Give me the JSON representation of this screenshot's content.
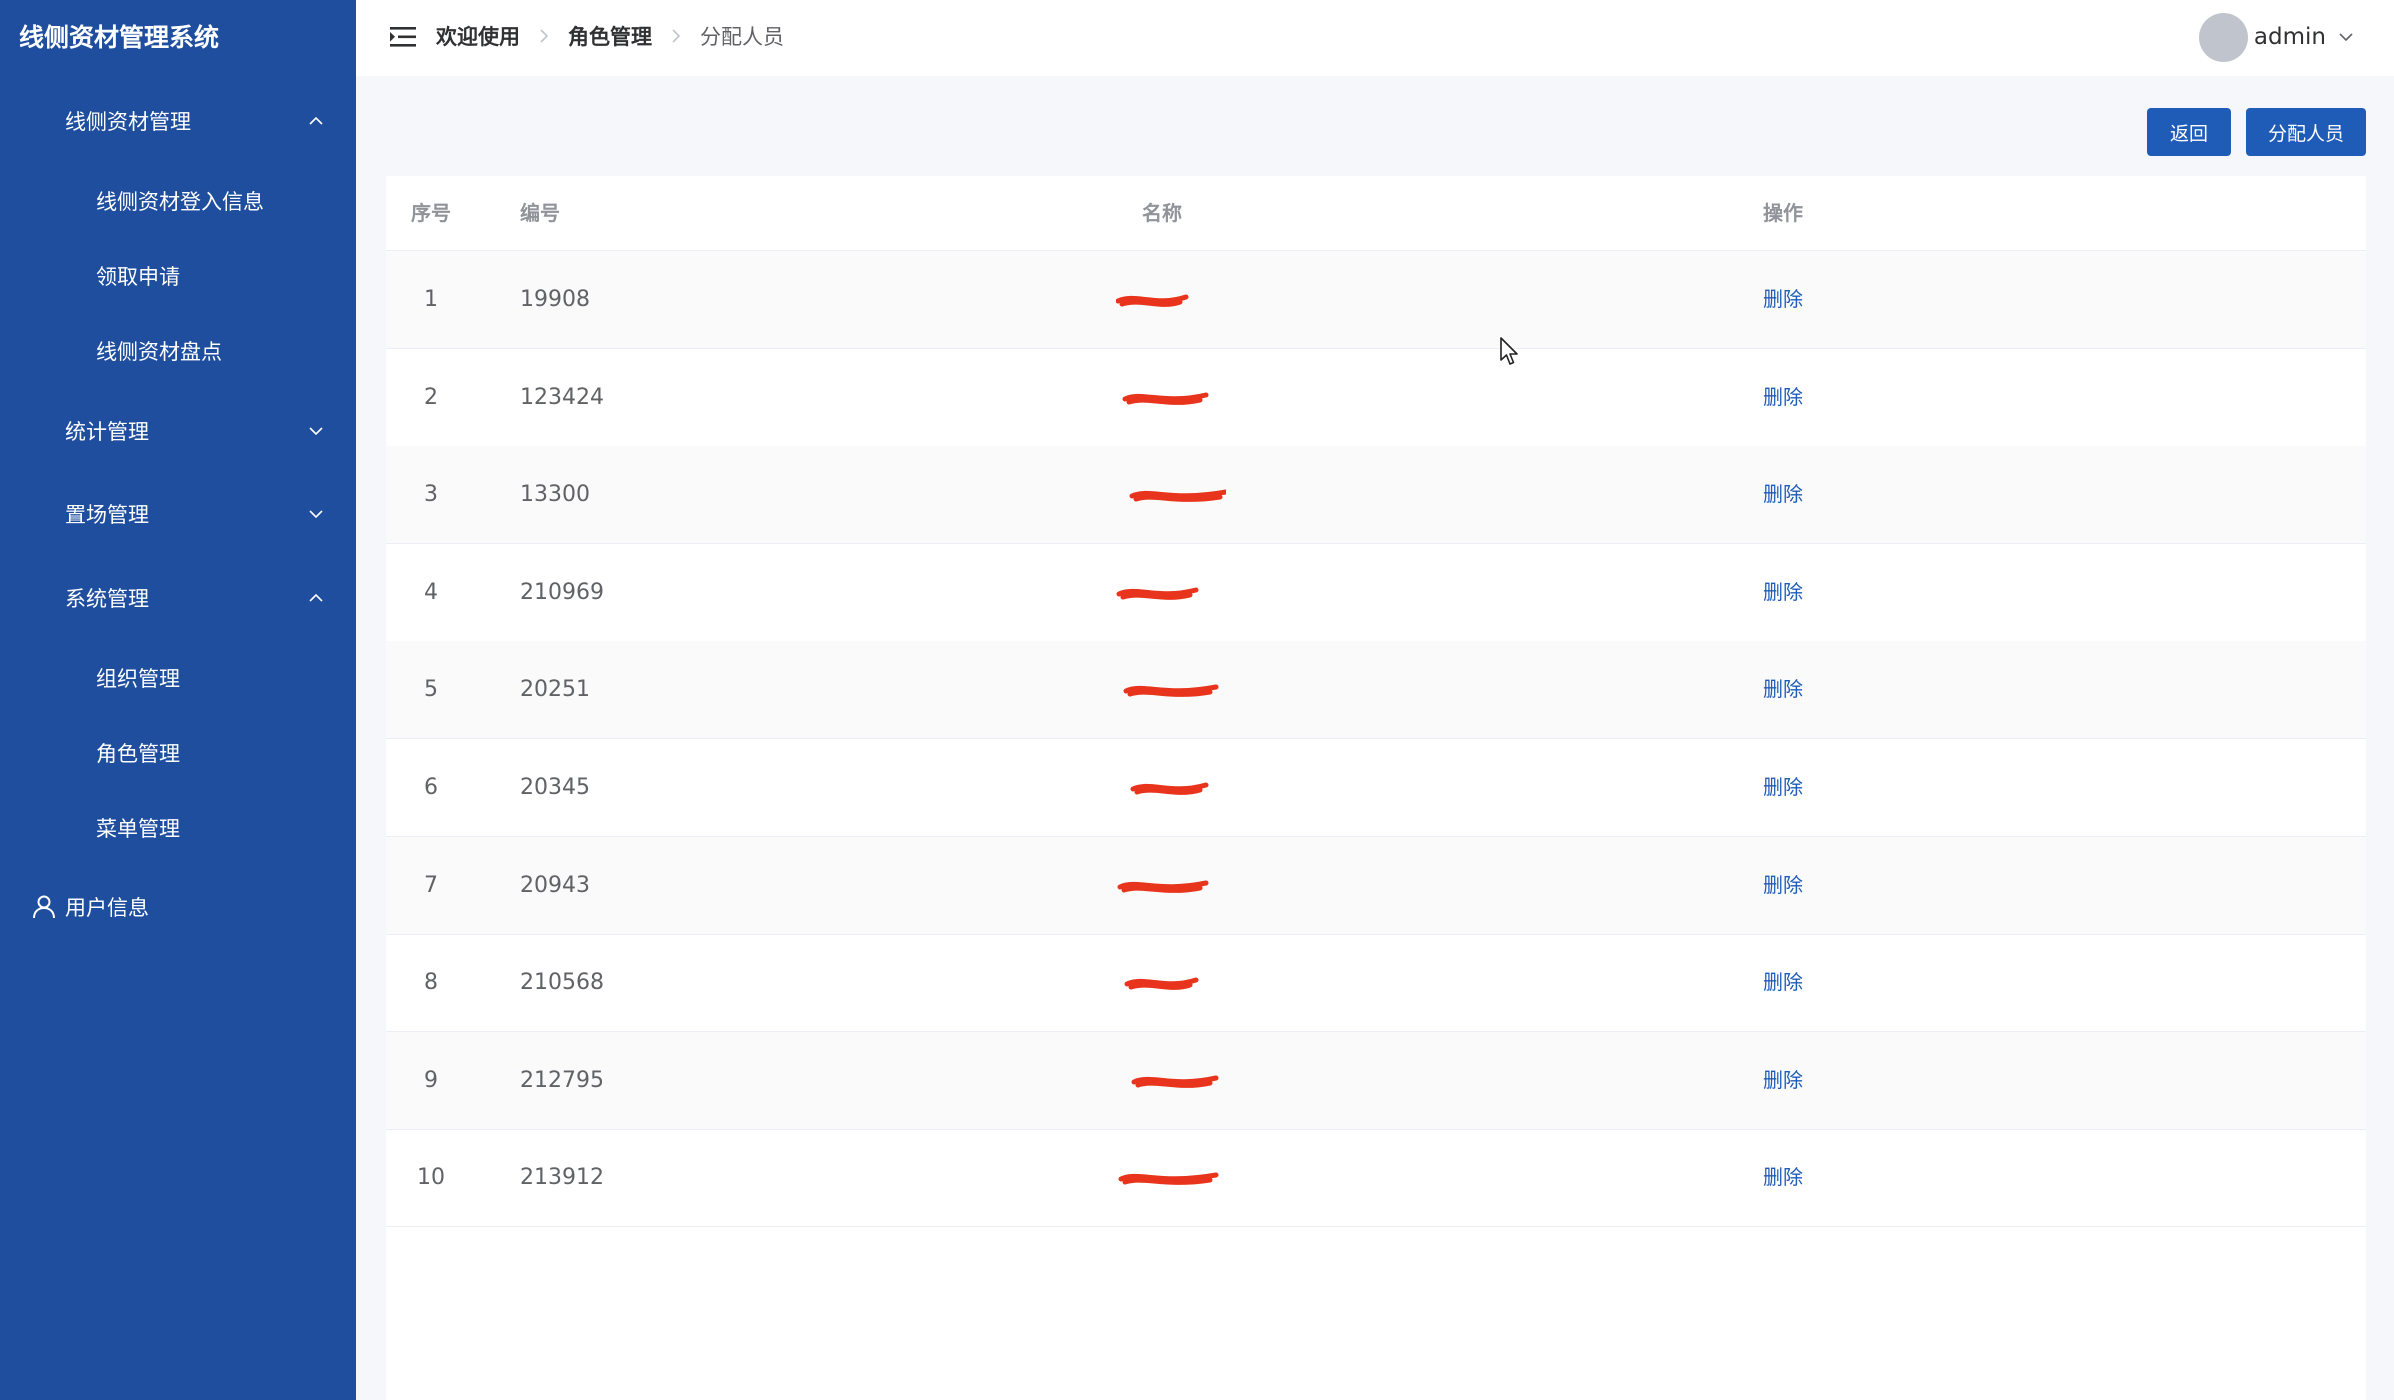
{
  "sidebar": {
    "brand": "线侧资材管理系统",
    "items": [
      {
        "label": "线侧资材管理",
        "type": "group",
        "expanded": true
      },
      {
        "label": "线侧资材登入信息",
        "type": "sub"
      },
      {
        "label": "领取申请",
        "type": "sub"
      },
      {
        "label": "线侧资材盘点",
        "type": "sub"
      },
      {
        "label": "统计管理",
        "type": "group",
        "expanded": false
      },
      {
        "label": "置场管理",
        "type": "group",
        "expanded": false
      },
      {
        "label": "系统管理",
        "type": "group",
        "expanded": true
      },
      {
        "label": "组织管理",
        "type": "sub"
      },
      {
        "label": "角色管理",
        "type": "sub"
      },
      {
        "label": "菜单管理",
        "type": "sub"
      },
      {
        "label": "用户信息",
        "type": "user"
      }
    ]
  },
  "header": {
    "breadcrumb": [
      "欢迎使用",
      "角色管理",
      "分配人员"
    ],
    "username": "admin"
  },
  "actions": {
    "back_label": "返回",
    "assign_label": "分配人员"
  },
  "table": {
    "columns": [
      "序号",
      "编号",
      "名称",
      "操作"
    ],
    "rows": [
      {
        "idx": "1",
        "code": "19908",
        "op": "删除"
      },
      {
        "idx": "2",
        "code": "123424",
        "op": "删除"
      },
      {
        "idx": "3",
        "code": "13300",
        "op": "删除"
      },
      {
        "idx": "4",
        "code": "210969",
        "op": "删除"
      },
      {
        "idx": "5",
        "code": "20251",
        "op": "删除"
      },
      {
        "idx": "6",
        "code": "20345",
        "op": "删除"
      },
      {
        "idx": "7",
        "code": "20943",
        "op": "删除"
      },
      {
        "idx": "8",
        "code": "210568",
        "op": "删除"
      },
      {
        "idx": "9",
        "code": "212795",
        "op": "删除"
      },
      {
        "idx": "10",
        "code": "213912",
        "op": "删除"
      }
    ]
  },
  "colors": {
    "sidebar_bg": "#1f4e9f",
    "primary": "#1f5cb8",
    "redaction": "#e8341c"
  },
  "icons": {
    "hamburger": "menu-fold-icon",
    "chevron": "chevron-icon",
    "user": "user-icon",
    "breadcrumb_separator": "chevron-right-icon"
  }
}
